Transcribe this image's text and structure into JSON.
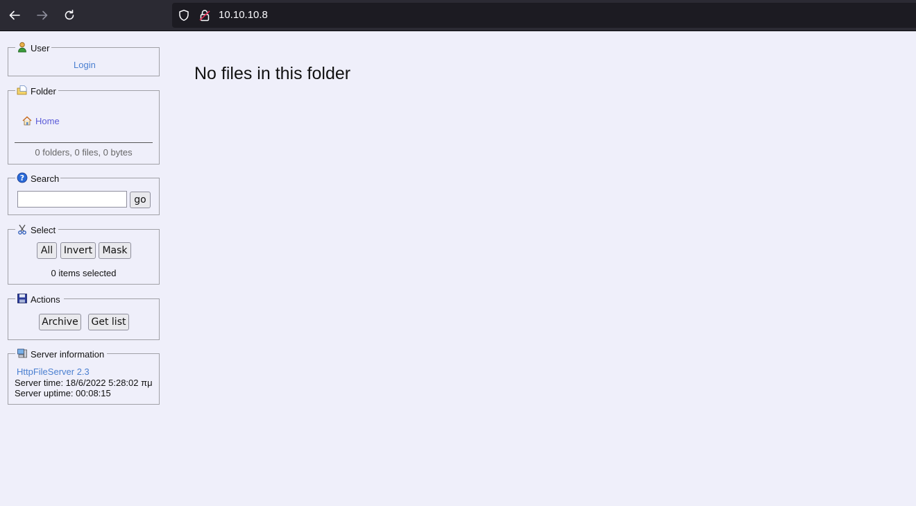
{
  "browser": {
    "url": "10.10.10.8",
    "back_icon": "arrow-left-icon",
    "forward_icon": "arrow-right-icon",
    "reload_icon": "reload-icon",
    "shield_icon": "shield-icon",
    "lock_icon": "insecure-lock-icon"
  },
  "sidebar": {
    "user": {
      "legend": "User",
      "login_label": "Login"
    },
    "folder": {
      "legend": "Folder",
      "home_label": "Home",
      "stats": "0 folders, 0 files, 0 bytes"
    },
    "search": {
      "legend": "Search",
      "input_value": "",
      "go_label": "go"
    },
    "select": {
      "legend": "Select",
      "all_label": "All",
      "invert_label": "Invert",
      "mask_label": "Mask",
      "status": "0 items selected"
    },
    "actions": {
      "legend": "Actions",
      "archive_label": "Archive",
      "getlist_label": "Get list"
    },
    "server": {
      "legend": "Server information",
      "software_link": "HttpFileServer 2.3",
      "time": "Server time: 18/6/2022 5:28:02 πμ",
      "uptime": "Server uptime: 00:08:15"
    }
  },
  "main": {
    "message": "No files in this folder"
  }
}
